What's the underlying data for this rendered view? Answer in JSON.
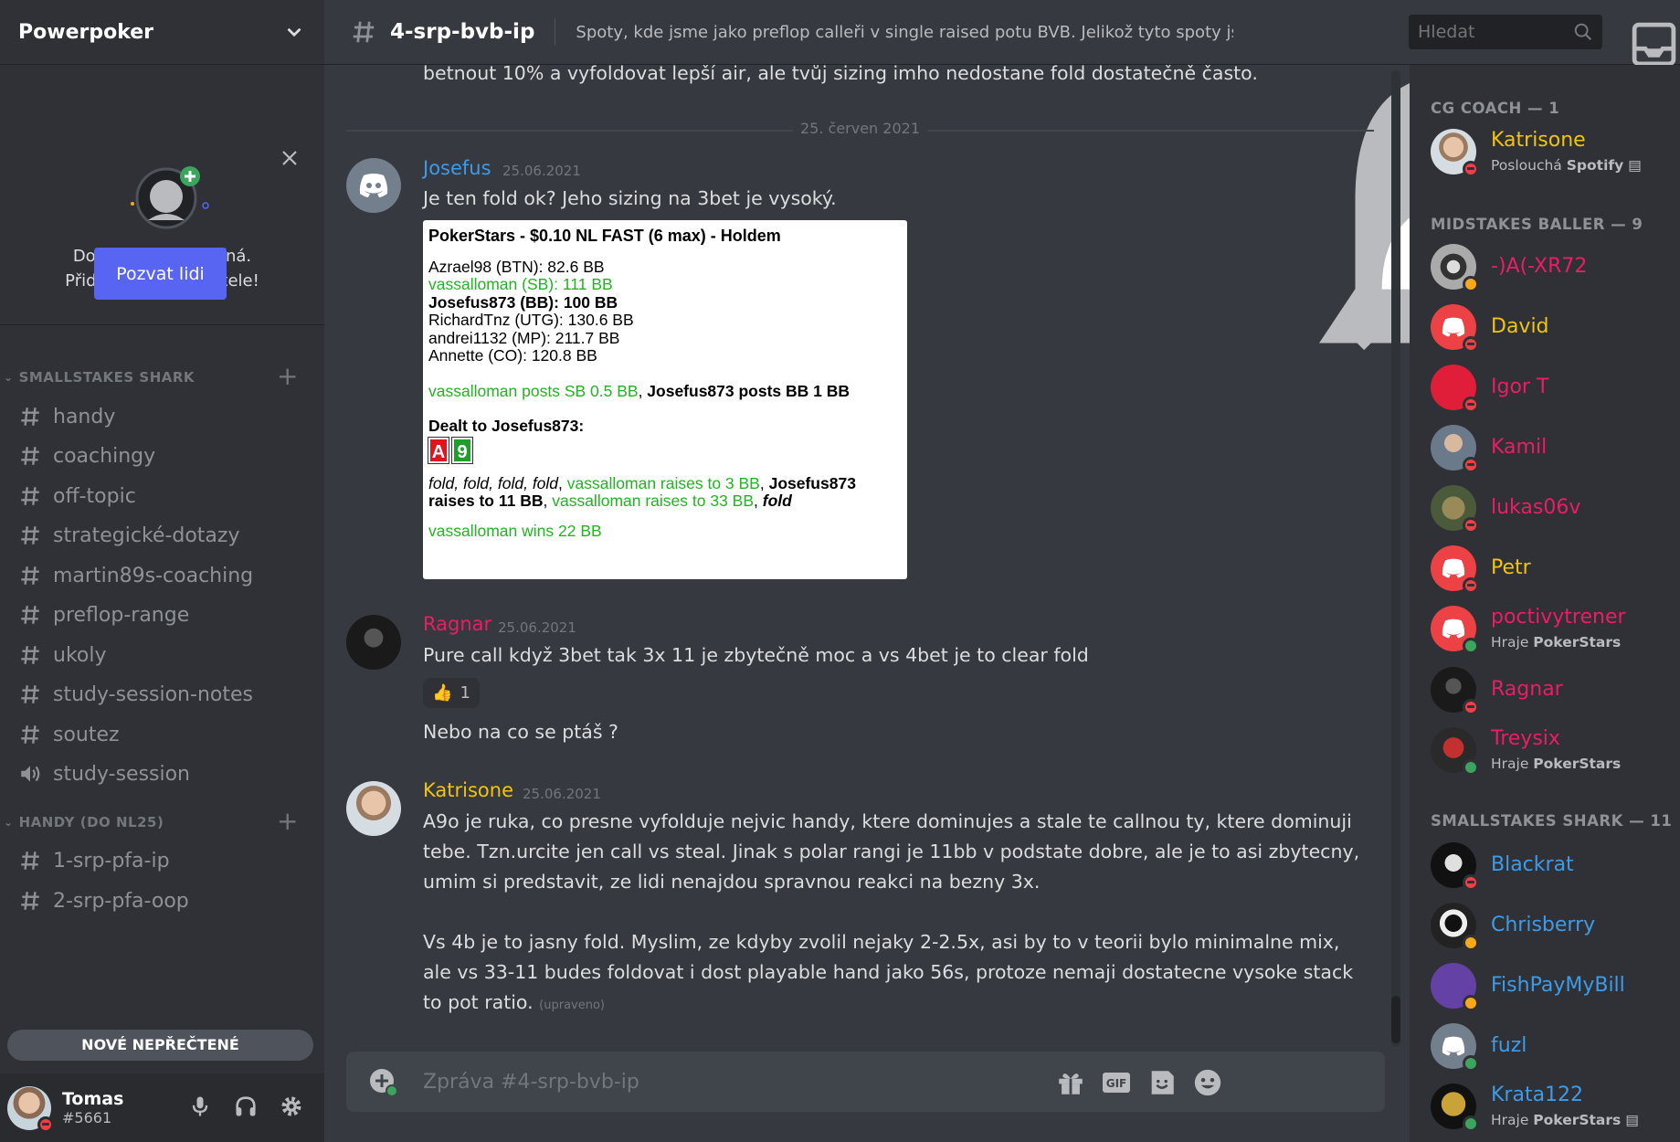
{
  "server": {
    "name": "Powerpoker"
  },
  "promo": {
    "line1": "Dobrodružství začíná.",
    "line2": "Přidej si nějaké přátele!",
    "button": "Pozvat lidi"
  },
  "categories": [
    {
      "name": "SMALLSTAKES SHARK",
      "channels": [
        "handy",
        "coachingy",
        "off-topic",
        "strategické-dotazy",
        "martin89s-coaching",
        "preflop-range",
        "ukoly",
        "study-session-notes",
        "soutez"
      ],
      "voice": [
        "study-session"
      ]
    },
    {
      "name": "HANDY (DO NL25)",
      "channels": [
        "1-srp-pfa-ip",
        "2-srp-pfa-oop"
      ]
    }
  ],
  "new_unread": "NOVÉ NEPŘEČTENÉ",
  "user": {
    "name": "Tomas",
    "tag": "#5661"
  },
  "channel": {
    "name": "4-srp-bvb-ip",
    "topic": "Spoty, kde jsme jako preflop calleři v single raised potu BVB. Jelikož tyto spoty js..."
  },
  "search": {
    "placeholder": "Hledat"
  },
  "chat": {
    "prev_text": "betnout 10% a vyfoldovat lepší air, ale tvůj sizing imho nedostane fold dostatečně často.",
    "date_separator": "25. červen 2021",
    "messages": [
      {
        "author": "Josefus",
        "author_color": "#3e9be8",
        "timestamp": "25.06.2021",
        "text": "Je ten fold ok? Jeho sizing na 3bet je vysoký."
      },
      {
        "author": "Ragnar",
        "author_color": "#e91e63",
        "timestamp": "25.06.2021",
        "text": "Pure call když 3bet tak 3x 11 je zbytečně moc a vs 4bet je to clear fold",
        "reaction": {
          "emoji": "👍",
          "count": "1"
        },
        "followup": "Nebo na co se ptáš ?"
      },
      {
        "author": "Katrisone",
        "author_color": "#f1c40f",
        "timestamp": "25.06.2021",
        "lines": [
          "A9o je ruka, co presne vyfolduje nejvic handy, ktere dominujes a stale te callnou ty, ktere dominuji",
          "tebe. Tzn.urcite jen call vs steal. Jinak s polar rangi je 11bb v podstate dobre, ale je to asi zbytecny,",
          "umim si predstavit, ze lidi nenajdou spravnou reakci na bezny 3x."
        ],
        "lines2": [
          "Vs 4b je to jasny fold. Myslim, ze kdyby zvolil nejaky 2-2.5x, asi by to v teorii bylo minimalne mix,",
          "ale vs 33-11 budes foldovat i dost playable hand jako 56s, protoze nemaji dostatecne vysoke stack",
          "to pot ratio."
        ],
        "edited": "(upraveno)"
      }
    ],
    "hand_history": {
      "title": "PokerStars - $0.10 NL FAST (6 max) - Holdem",
      "players": [
        {
          "text": "Azrael98 (BTN): 82.6 BB",
          "style": "normal"
        },
        {
          "text": "vassalloman (SB): 111 BB",
          "style": "green"
        },
        {
          "text": "Josefus873 (BB): 100 BB",
          "style": "bold"
        },
        {
          "text": "RichardTnz (UTG): 130.6 BB",
          "style": "normal"
        },
        {
          "text": "andrei1132 (MP): 211.7 BB",
          "style": "normal"
        },
        {
          "text": "Annette (CO): 120.8 BB",
          "style": "normal"
        }
      ],
      "posts_sb": "vassalloman posts SB 0.5 BB",
      "posts_sep": ", ",
      "posts_bb": "Josefus873 posts BB 1 BB",
      "dealt": "Dealt to Josefus873:",
      "cards": [
        {
          "rank": "A",
          "color": "#e0141c"
        },
        {
          "rank": "9",
          "color": "#1e9e2a"
        }
      ],
      "action_folds": "fold, fold, fold, fold",
      "action_sep1": ", ",
      "action_raise1": "vassalloman raises to 3 BB",
      "action_sep2": ", ",
      "action_hero1": "Josefus873",
      "action_hero2": "raises to 11 BB",
      "action_sep3": ", ",
      "action_raise2": "vassalloman raises to 33 BB",
      "action_sep4": ", ",
      "action_fold": "fold",
      "result": "vassalloman wins 22 BB"
    }
  },
  "composer": {
    "placeholder": "Zpráva #4-srp-bvb-ip"
  },
  "members": {
    "groups": [
      {
        "title": "CG COACH — 1"
      },
      {
        "title": "MIDSTAKES BALLER — 9"
      },
      {
        "title": "SMALLSTAKES SHARK — 11"
      }
    ],
    "list": [
      {
        "name": "Katrisone",
        "color": "#f1c40f",
        "activity_prefix": "Poslouchá ",
        "activity_bold": "Spotify",
        "status": "dnd"
      },
      {
        "name": "-)A(-XR72",
        "color": "#e91e63",
        "status": "idle"
      },
      {
        "name": "David",
        "color": "#f1c40f",
        "status": "dnd"
      },
      {
        "name": "Igor T",
        "color": "#e91e63",
        "status": "dnd"
      },
      {
        "name": "Kamil",
        "color": "#e91e63",
        "status": "dnd"
      },
      {
        "name": "lukas06v",
        "color": "#e91e63",
        "status": "dnd"
      },
      {
        "name": "Petr",
        "color": "#f1c40f",
        "status": "dnd"
      },
      {
        "name": "poctivytrener",
        "color": "#e91e63",
        "activity_prefix": "Hraje ",
        "activity_bold": "PokerStars",
        "status": "online"
      },
      {
        "name": "Ragnar",
        "color": "#e91e63",
        "status": "dnd"
      },
      {
        "name": "Treysix",
        "color": "#e91e63",
        "activity_prefix": "Hraje ",
        "activity_bold": "PokerStars",
        "status": "online"
      },
      {
        "name": "Blackrat",
        "color": "#3e9be8",
        "status": "dnd"
      },
      {
        "name": "Chrisberry",
        "color": "#3e9be8",
        "status": "idle"
      },
      {
        "name": "FishPayMyBill",
        "color": "#3e9be8",
        "status": "idle"
      },
      {
        "name": "fuzl",
        "color": "#3e9be8",
        "status": "online"
      },
      {
        "name": "Krata122",
        "color": "#3e9be8",
        "activity_prefix": "Hraje ",
        "activity_bold": "PokerStars",
        "status": "online"
      }
    ]
  },
  "colors": {
    "accent": "#5865f2",
    "background": "#36393f",
    "sidebar": "#2f3136"
  }
}
